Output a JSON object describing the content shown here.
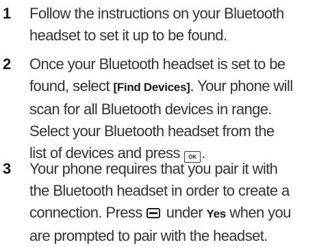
{
  "steps": [
    {
      "number": "1",
      "lines": [
        "Follow the instructions on your Bluetooth",
        "headset to set it up to be found."
      ]
    },
    {
      "number": "2",
      "line1": "Once your Bluetooth headset is set to be",
      "line2_pre": "found, select ",
      "line2_key": "[Find Devices]",
      "line2_post": ". Your phone will",
      "line3": "scan for all Bluetooth devices in range.",
      "line4": "Select your Bluetooth headset from the",
      "line5_pre": "list of devices and press ",
      "ok_key_label": "OK",
      "line5_post": "."
    },
    {
      "number": "3",
      "line1": "Your phone requires that you pair it with",
      "line2": "the Bluetooth headset in order to create a",
      "line3_pre": "connection. Press ",
      "softkey_icon": "softkey-icon",
      "line3_mid": " under ",
      "line3_key": "Yes",
      "line3_post": " when you",
      "line4": "are prompted to pair with the headset."
    }
  ]
}
